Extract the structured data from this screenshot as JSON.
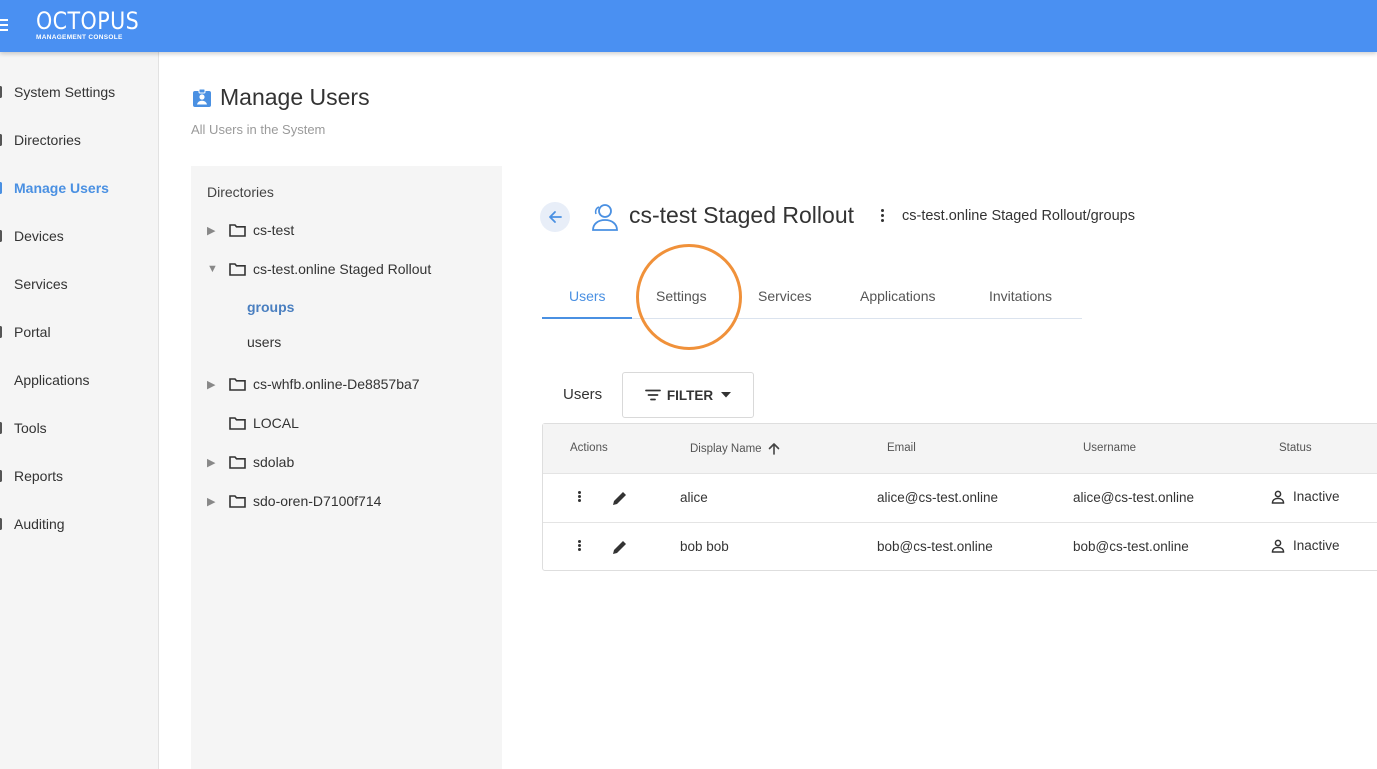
{
  "header": {
    "logo_main": "OCTOPUS",
    "logo_sub": "MANAGEMENT CONSOLE",
    "accent": "#4a90f2"
  },
  "sidebar": {
    "items": [
      {
        "label": "System Settings",
        "active": false
      },
      {
        "label": "Directories",
        "active": false
      },
      {
        "label": "Manage Users",
        "active": true
      },
      {
        "label": "Devices",
        "active": false
      },
      {
        "label": "Services",
        "active": false
      },
      {
        "label": "Portal",
        "active": false
      },
      {
        "label": "Applications",
        "active": false
      },
      {
        "label": "Tools",
        "active": false
      },
      {
        "label": "Reports",
        "active": false
      },
      {
        "label": "Auditing",
        "active": false
      }
    ]
  },
  "page": {
    "title": "Manage Users",
    "subtitle": "All Users in the System",
    "title_icon": "user-badge-icon"
  },
  "tree": {
    "heading": "Directories",
    "nodes": [
      {
        "label": "cs-test",
        "expandable": true,
        "expanded": false
      },
      {
        "label": "cs-test.online Staged Rollout",
        "expandable": true,
        "expanded": true,
        "children": [
          {
            "label": "groups",
            "active": true
          },
          {
            "label": "users",
            "active": false
          }
        ]
      },
      {
        "label": "cs-whfb.online-De8857ba7",
        "expandable": true,
        "expanded": false
      },
      {
        "label": "LOCAL",
        "expandable": false,
        "expanded": false
      },
      {
        "label": "sdolab",
        "expandable": true,
        "expanded": false
      },
      {
        "label": "sdo-oren-D7100f714",
        "expandable": true,
        "expanded": false
      }
    ]
  },
  "detail": {
    "title": "cs-test Staged Rollout",
    "path": "cs-test.online Staged Rollout/groups",
    "tabs": [
      {
        "label": "Users",
        "active": true
      },
      {
        "label": "Settings",
        "active": false
      },
      {
        "label": "Services",
        "active": false
      },
      {
        "label": "Applications",
        "active": false
      },
      {
        "label": "Invitations",
        "active": false
      }
    ],
    "highlight_color": "#f0913a"
  },
  "users_section": {
    "label": "Users",
    "filter_label": "FILTER"
  },
  "table": {
    "columns": [
      "Actions",
      "Display Name",
      "Email",
      "Username",
      "Status"
    ],
    "sort_column": "Display Name",
    "sort_direction": "asc",
    "rows": [
      {
        "display_name": "alice",
        "email": "alice@cs-test.online",
        "username": "alice@cs-test.online",
        "status": "Inactive"
      },
      {
        "display_name": "bob bob",
        "email": "bob@cs-test.online",
        "username": "bob@cs-test.online",
        "status": "Inactive"
      }
    ]
  }
}
